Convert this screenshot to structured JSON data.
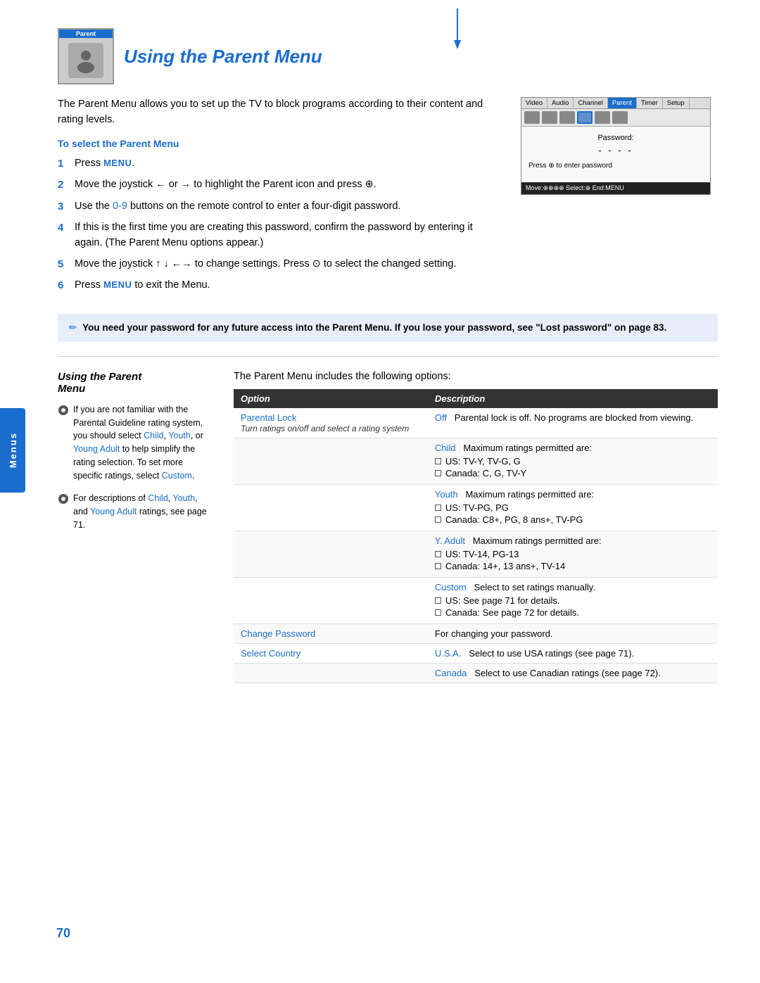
{
  "sidebar": {
    "tab_label": "Menus"
  },
  "page_number": "70",
  "title": {
    "badge": "Parent",
    "heading": "Using the Parent Menu"
  },
  "intro": "The Parent Menu allows you to set up the TV to block programs according to their content and rating levels.",
  "to_select_heading": "To select the Parent Menu",
  "steps": [
    {
      "num": "1",
      "text": "Press ",
      "highlight": "MENU",
      "rest": "."
    },
    {
      "num": "2",
      "text": "Move the joystick ← or → to highlight the Parent icon and press ⊕."
    },
    {
      "num": "3",
      "text": "Use the ",
      "highlight": "0-9",
      "rest": " buttons on the remote control to enter a four-digit password."
    },
    {
      "num": "4",
      "text": "If this is the first time you are creating this password, confirm the password by entering it again. (The Parent Menu options appear.)"
    },
    {
      "num": "5",
      "text": "Move the joystick ↑ ↓ ←→ to change settings. Press ⊙ to select the changed setting."
    },
    {
      "num": "6",
      "text": "Press ",
      "highlight": "MENU",
      "rest": " to exit the Menu."
    }
  ],
  "note": "You need your password for any future access into the Parent Menu. If you lose your password, see \"Lost password\" on page 83.",
  "tv_screenshot": {
    "menu_items": [
      "Video",
      "Audio",
      "Channel",
      "Parent",
      "Timer",
      "Setup"
    ],
    "active_menu": "Parent",
    "password_label": "Password:",
    "password_dashes": "- - - -",
    "instruction": "Press ⊕ to enter password",
    "footer": "Move:⊕⊕⊕⊕  Select:⊕  End:MENU"
  },
  "second_section": {
    "title": "Using the Parent Menu",
    "includes_text": "The Parent Menu includes the following options:",
    "left_note1": "If you are not familiar with the Parental Guideline rating system, you should select Child, Youth, or Young Adult to help simplify the rating selection. To set more specific ratings, select Custom.",
    "left_note2": "For descriptions of Child, Youth, and Young Adult ratings, see page 71.",
    "table_headers": [
      "Option",
      "Description"
    ],
    "table_rows": [
      {
        "option": "Parental Lock",
        "option_sub": "Turn ratings on/off and select a rating system",
        "desc_main": "Off",
        "desc_text": "Parental lock is off. No programs are blocked from viewing.",
        "bullets": []
      },
      {
        "option": "",
        "option_sub": "",
        "desc_main": "Child",
        "desc_text": "Maximum ratings permitted are:",
        "bullets": [
          "US: TV-Y, TV-G, G",
          "Canada: C, G, TV-Y"
        ]
      },
      {
        "option": "",
        "option_sub": "",
        "desc_main": "Youth",
        "desc_text": "Maximum ratings permitted are:",
        "bullets": [
          "US: TV-PG, PG",
          "Canada: C8+, PG, 8 ans+, TV-PG"
        ]
      },
      {
        "option": "",
        "option_sub": "",
        "desc_main": "Y. Adult",
        "desc_text": "Maximum ratings permitted are:",
        "bullets": [
          "US: TV-14, PG-13",
          "Canada: 14+, 13 ans+, TV-14"
        ]
      },
      {
        "option": "",
        "option_sub": "",
        "desc_main": "Custom",
        "desc_text": "Select to set ratings manually.",
        "bullets": [
          "US: See page 71 for details.",
          "Canada: See page 72 for details."
        ]
      },
      {
        "option": "Change Password",
        "option_sub": "",
        "desc_main": "",
        "desc_text": "For changing your password.",
        "bullets": []
      },
      {
        "option": "Select Country",
        "option_sub": "",
        "desc_main": "U.S.A.",
        "desc_text": "Select to use USA ratings (see page 71).",
        "bullets": []
      },
      {
        "option": "",
        "option_sub": "",
        "desc_main": "Canada",
        "desc_text": "Select to use Canadian ratings (see page 72).",
        "bullets": []
      }
    ]
  }
}
